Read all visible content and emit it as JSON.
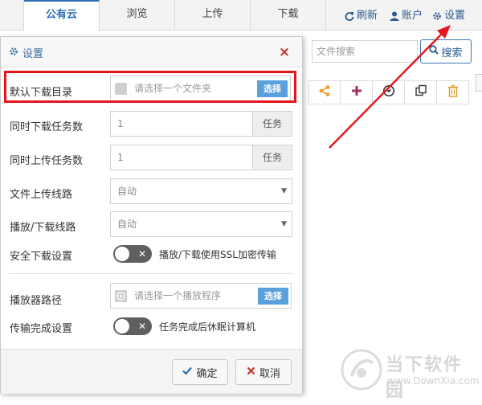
{
  "topnav": {
    "tabs": [
      {
        "label": ""
      },
      {
        "label": "公有云"
      },
      {
        "label": "浏览"
      },
      {
        "label": "上传"
      },
      {
        "label": "下载"
      }
    ],
    "actions": {
      "refresh": "刷新",
      "account": "账户",
      "settings": "设置"
    }
  },
  "background": {
    "search_placeholder": "文件搜索",
    "search_button": "搜索",
    "toolbar_icons": [
      "share-icon",
      "plus-icon",
      "download-icon",
      "copy-icon",
      "trash-icon"
    ]
  },
  "dialog": {
    "title": "设置",
    "close": "×",
    "rows": {
      "download_dir": {
        "label": "默认下载目录",
        "placeholder": "请选择一个文件夹",
        "button": "选择"
      },
      "concurrent_download": {
        "label": "同时下载任务数",
        "value": "1",
        "addon": "任务"
      },
      "concurrent_upload": {
        "label": "同时上传任务数",
        "value": "1",
        "addon": "任务"
      },
      "upload_route": {
        "label": "文件上传线路",
        "value": "自动"
      },
      "playback_route": {
        "label": "播放/下载线路",
        "value": "自动"
      },
      "secure_download": {
        "label": "安全下载设置",
        "desc": "播放/下载使用SSL加密传输"
      },
      "player_path": {
        "label": "播放器路径",
        "placeholder": "请选择一个播放程序",
        "button": "选择"
      },
      "transfer_done": {
        "label": "传输完成设置",
        "desc": "任务完成后休眠计算机"
      }
    },
    "footer": {
      "ok": "确定",
      "cancel": "取消"
    }
  },
  "colors": {
    "accent": "#2a6db5",
    "highlight": "#e8141c",
    "select_button": "#5aa0dc"
  },
  "watermark": {
    "main": "当下软件园",
    "sub": "www.DownXia.com"
  }
}
